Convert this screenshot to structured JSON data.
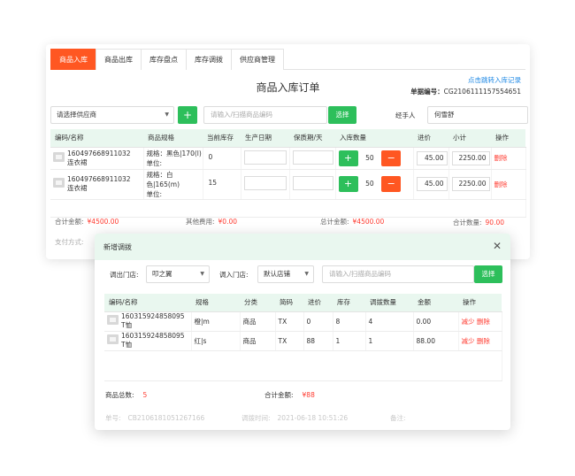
{
  "tabs": [
    {
      "label": "商品入库",
      "active": true
    },
    {
      "label": "商品出库",
      "active": false
    },
    {
      "label": "库存盘点",
      "active": false
    },
    {
      "label": "库存调拨",
      "active": false
    },
    {
      "label": "供应商管理",
      "active": false
    }
  ],
  "order": {
    "title": "商品入库订单",
    "jump_link": "点击跳转入库记录",
    "order_no_label": "单据编号：",
    "order_no": "CG2106111157554651"
  },
  "filters": {
    "supplier_placeholder": "请选择供应商",
    "add_icon": "+",
    "search_placeholder": "请输入/扫描商品编码",
    "select_label": "选择",
    "handler_label": "经手人",
    "handler_value": "何雪舒"
  },
  "inbound_table": {
    "headers": [
      "编码/名称",
      "商品规格",
      "当前库存",
      "生产日期",
      "保质期/天",
      "入库数量",
      "进价",
      "小计",
      "操作"
    ],
    "rows": [
      {
        "code": "160497668911032",
        "name": "连衣裙",
        "spec1": "规格：黑色|170(l)",
        "spec2": "单位:",
        "stock": "0",
        "qty": "50",
        "price": "45.00",
        "subtotal": "2250.00",
        "action": "删除"
      },
      {
        "code": "160497668911032",
        "name": "连衣裙",
        "spec1": "规格：白色|165(m)",
        "spec2": "单位:",
        "stock": "15",
        "qty": "50",
        "price": "45.00",
        "subtotal": "2250.00",
        "action": "删除"
      }
    ]
  },
  "inbound_summary": {
    "total_label": "合计金额:",
    "total_value": "¥4500.00",
    "other_label": "其他费用:",
    "other_value": "¥0.00",
    "grand_label": "总计金额:",
    "grand_value": "¥4500.00",
    "count_label": "合计数量:",
    "count_value": "90.00",
    "payment_label": "支付方式:"
  },
  "modal": {
    "title": "新增调拨",
    "close_icon": "✕",
    "out_store_label": "调出门店:",
    "out_store_value": "叩之翼",
    "in_store_label": "调入门店:",
    "in_store_value": "默认店铺",
    "search_placeholder": "请输入/扫描商品编码",
    "select_label": "选择",
    "headers": [
      "编码/名称",
      "规格",
      "分类",
      "简码",
      "进价",
      "库存",
      "调拨数量",
      "金额",
      "操作"
    ],
    "rows": [
      {
        "code": "160315924858095",
        "name": "T恤",
        "spec": "橙|m",
        "category": "商品",
        "short": "TX",
        "price": "0",
        "stock": "8",
        "qty": "4",
        "amount": "0.00",
        "action1": "减少",
        "action2": "删除"
      },
      {
        "code": "160315924858095",
        "name": "T恤",
        "spec": "红|s",
        "category": "商品",
        "short": "TX",
        "price": "88",
        "stock": "1",
        "qty": "1",
        "amount": "88.00",
        "action1": "减少",
        "action2": "删除"
      }
    ],
    "count_label": "商品总数:",
    "count_value": "5",
    "total_label": "合计金额:",
    "total_value": "¥88",
    "footer_no_label": "单号:",
    "footer_no": "CB2106181051267166",
    "footer_time_label": "调拨时间:",
    "footer_time": "2021-06-18 10:51:26",
    "footer_note_label": "备注:"
  }
}
